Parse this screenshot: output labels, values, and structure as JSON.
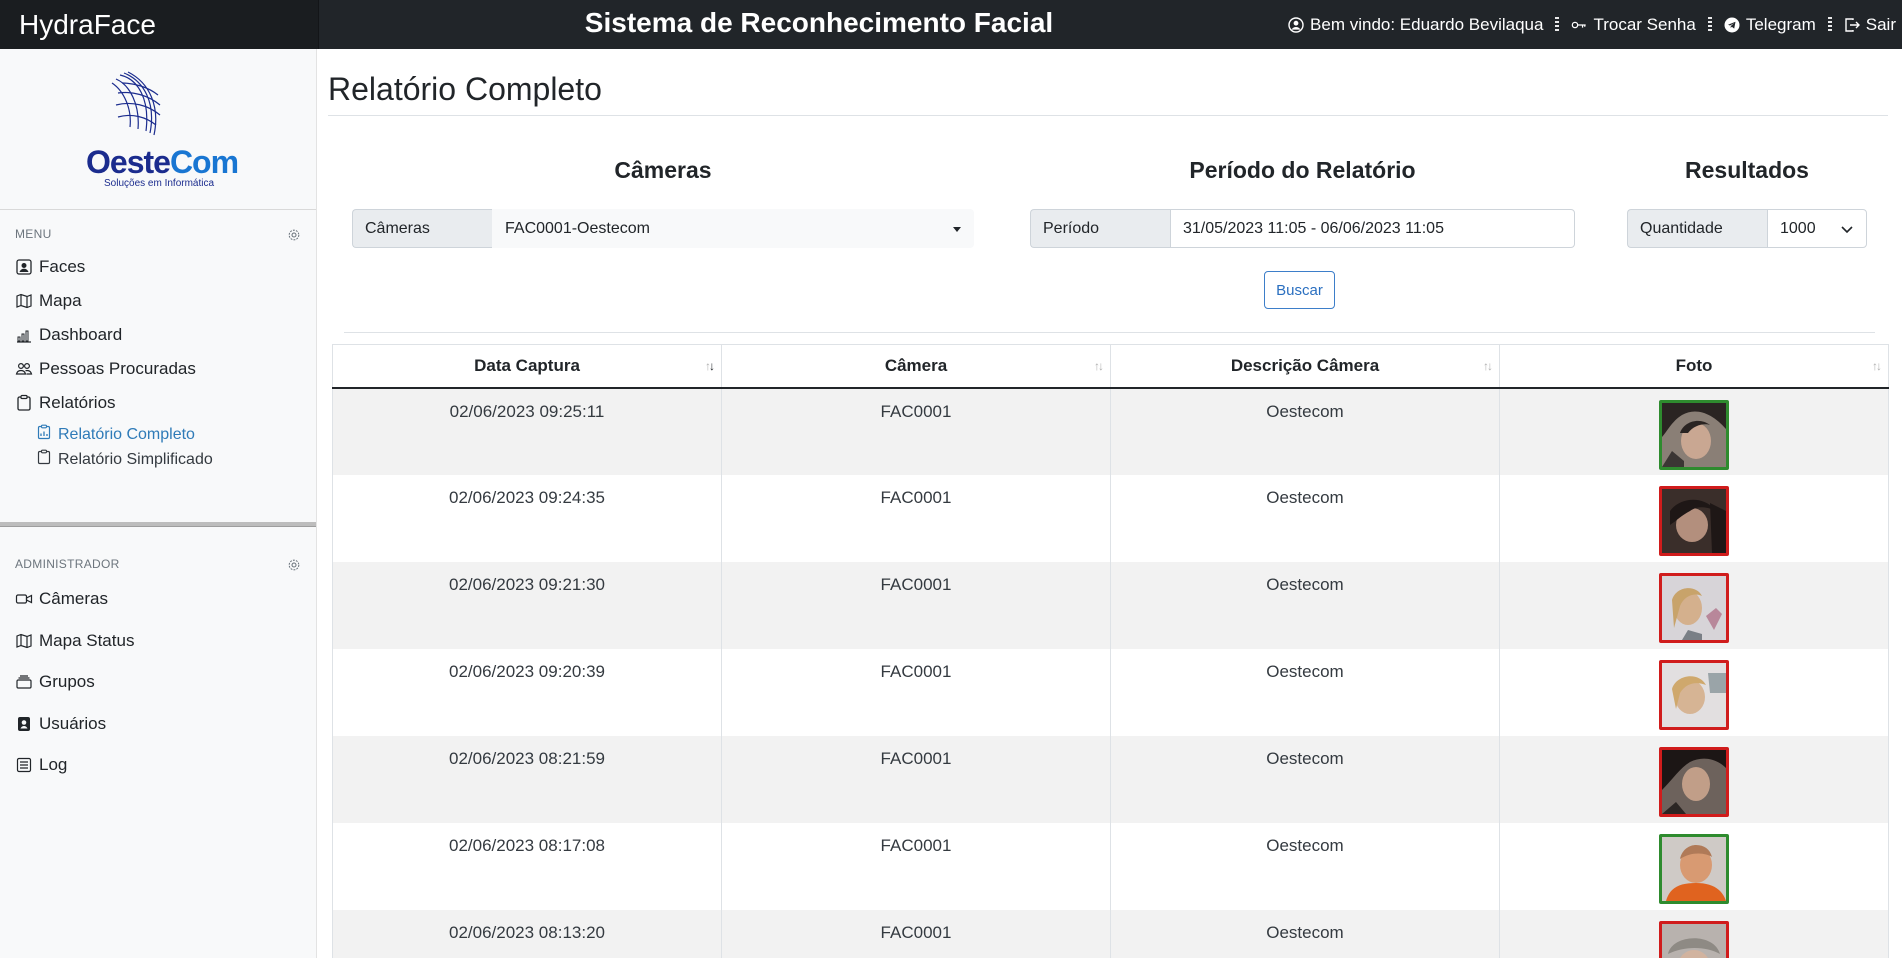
{
  "brand": "HydraFace",
  "app_title": "Sistema de Reconhecimento Facial",
  "topnav": {
    "welcome": "Bem vindo: Eduardo Bevilaqua",
    "change_password": "Trocar Senha",
    "telegram": "Telegram",
    "logout": "Sair"
  },
  "logo": {
    "word_a": "Oeste",
    "word_b": "Com",
    "tagline": "Soluções em Informática"
  },
  "sidebar": {
    "menu_header": "MENU",
    "menu_items": [
      {
        "label": "Faces",
        "icon": "person-badge-icon"
      },
      {
        "label": "Mapa",
        "icon": "map-icon"
      },
      {
        "label": "Dashboard",
        "icon": "bar-chart-icon"
      },
      {
        "label": "Pessoas Procuradas",
        "icon": "people-icon"
      },
      {
        "label": "Relatórios",
        "icon": "clipboard-icon"
      }
    ],
    "sub_items": [
      {
        "label": "Relatório Completo",
        "active": true
      },
      {
        "label": "Relatório Simplificado",
        "active": false
      }
    ],
    "admin_header": "ADMINISTRADOR",
    "admin_items": [
      {
        "label": "Câmeras",
        "icon": "camera-video-icon"
      },
      {
        "label": "Mapa Status",
        "icon": "map-icon"
      },
      {
        "label": "Grupos",
        "icon": "collection-icon"
      },
      {
        "label": "Usuários",
        "icon": "person-square-icon"
      },
      {
        "label": "Log",
        "icon": "journal-icon"
      }
    ]
  },
  "page": {
    "title": "Relatório Completo"
  },
  "filters": {
    "cameras": {
      "heading": "Câmeras",
      "label": "Câmeras",
      "value": "FAC0001-Oestecom"
    },
    "period": {
      "heading": "Período do Relatório",
      "label": "Período",
      "value": "31/05/2023 11:05 - 06/06/2023 11:05"
    },
    "results": {
      "heading": "Resultados",
      "label": "Quantidade",
      "value": "1000"
    },
    "search_button": "Buscar"
  },
  "table": {
    "columns": [
      "Data Captura",
      "Câmera",
      "Descrição Câmera",
      "Foto"
    ],
    "rows": [
      {
        "date": "02/06/2023 09:25:11",
        "camera": "FAC0001",
        "description": "Oestecom",
        "match": "green"
      },
      {
        "date": "02/06/2023 09:24:35",
        "camera": "FAC0001",
        "description": "Oestecom",
        "match": "red"
      },
      {
        "date": "02/06/2023 09:21:30",
        "camera": "FAC0001",
        "description": "Oestecom",
        "match": "red"
      },
      {
        "date": "02/06/2023 09:20:39",
        "camera": "FAC0001",
        "description": "Oestecom",
        "match": "red"
      },
      {
        "date": "02/06/2023 08:21:59",
        "camera": "FAC0001",
        "description": "Oestecom",
        "match": "red"
      },
      {
        "date": "02/06/2023 08:17:08",
        "camera": "FAC0001",
        "description": "Oestecom",
        "match": "green"
      },
      {
        "date": "02/06/2023 08:13:20",
        "camera": "FAC0001",
        "description": "Oestecom",
        "match": "red"
      }
    ]
  },
  "colors": {
    "topbar": "#212529",
    "accent_link": "#2f7bb8",
    "match_green": "#2e8b2e",
    "match_red": "#d01c1c"
  }
}
